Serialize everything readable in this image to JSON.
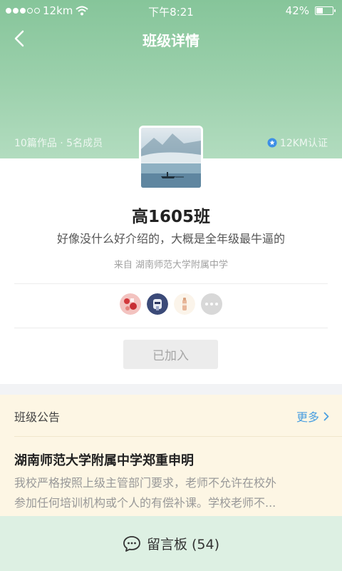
{
  "status": {
    "carrier": "12km",
    "time": "下午8:21",
    "battery": "42%",
    "battery_level": 0.42
  },
  "nav": {
    "title": "班级详情"
  },
  "header": {
    "stats": "10篇作品 · 5名成员",
    "cert": "12KM认证"
  },
  "klass": {
    "name": "高1605班",
    "intro": "好像没什么好介绍的，大概是全年级最牛逼的",
    "from": "来自  湖南师范大学附属中学"
  },
  "members": [
    {
      "icon": "member-avatar-1"
    },
    {
      "icon": "member-avatar-2"
    },
    {
      "icon": "member-avatar-3"
    }
  ],
  "joined_label": "已加入",
  "notice": {
    "title": "班级公告",
    "more": "更多",
    "headline": "湖南师范大学附属中学郑重申明",
    "body_line1": "我校严格按照上级主管部门要求，老师不允许在校外",
    "body_line2": "参加任何培训机构或个人的有偿补课。学校老师不..."
  },
  "bottom": {
    "label": "留言板 (54)"
  },
  "colors": {
    "accent": "#4a9fe0",
    "header_green": "#8cc9a0",
    "notice_bg": "#fdf6e4",
    "bottom_bg": "#ddf0e3"
  }
}
